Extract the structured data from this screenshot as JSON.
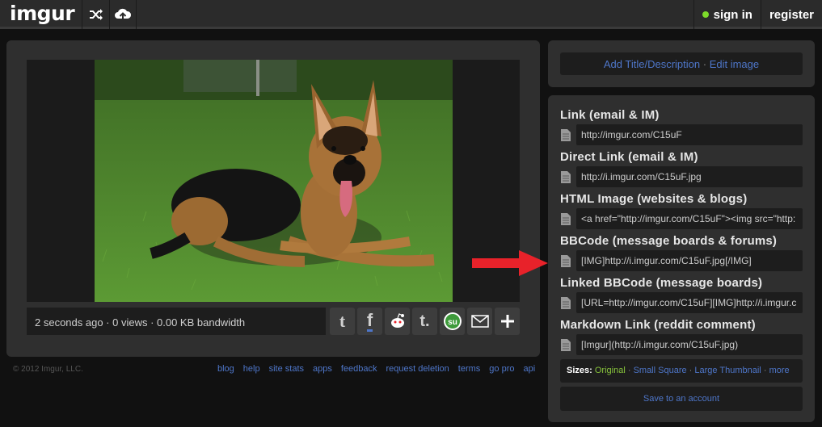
{
  "header": {
    "logo": "imgur",
    "signin_label": "sign in",
    "register_label": "register"
  },
  "image": {
    "stats": "2 seconds ago · 0 views · 0.00 KB bandwidth"
  },
  "share_buttons": [
    "twitter-icon",
    "facebook-icon",
    "reddit-icon",
    "tumblr-icon",
    "stumbleupon-icon",
    "email-icon",
    "plus-icon"
  ],
  "footer": {
    "copyright": "© 2012 Imgur, LLC.",
    "links": [
      "blog",
      "help",
      "site stats",
      "apps",
      "feedback",
      "request deletion",
      "terms",
      "go pro",
      "api"
    ]
  },
  "edit": {
    "add_title": "Add Title/Description",
    "separator": "·",
    "edit_image": "Edit image"
  },
  "links": [
    {
      "label": "Link (email & IM)",
      "value": "http://imgur.com/C15uF"
    },
    {
      "label": "Direct Link (email & IM)",
      "value": "http://i.imgur.com/C15uF.jpg"
    },
    {
      "label": "HTML Image (websites & blogs)",
      "value": "<a href=\"http://imgur.com/C15uF\"><img src=\"http:"
    },
    {
      "label": "BBCode (message boards & forums)",
      "value": "[IMG]http://i.imgur.com/C15uF.jpg[/IMG]"
    },
    {
      "label": "Linked BBCode (message boards)",
      "value": "[URL=http://imgur.com/C15uF][IMG]http://i.imgur.c"
    },
    {
      "label": "Markdown Link (reddit comment)",
      "value": "[Imgur](http://i.imgur.com/C15uF.jpg)"
    }
  ],
  "sizes": {
    "label": "Sizes:",
    "original": "Original",
    "sep": "·",
    "small_square": "Small Square",
    "large_thumbnail": "Large Thumbnail",
    "more": "more"
  },
  "save_label": "Save to an account",
  "colors": {
    "link_blue": "#4e76c9",
    "accent_green": "#88c43c",
    "arrow_red": "#e8222a"
  }
}
